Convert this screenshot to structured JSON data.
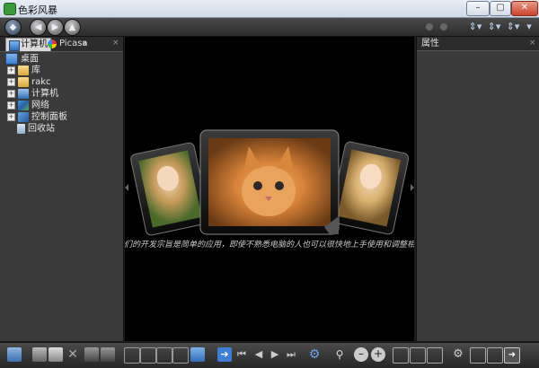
{
  "window": {
    "title": "色彩风暴",
    "controls": {
      "minimize": "–",
      "restore": "▢",
      "close": "✕"
    }
  },
  "left_panel": {
    "tabs": [
      {
        "label": "计算机",
        "icon": "computer-icon"
      },
      {
        "label": "Picasa",
        "icon": "picasa-icon"
      }
    ],
    "overflow_label": "»",
    "close_label": "×",
    "tree": [
      {
        "label": "桌面",
        "icon": "desktop-icon",
        "expandable": false
      },
      {
        "label": "库",
        "icon": "library-folder-icon",
        "expandable": true
      },
      {
        "label": "rakc",
        "icon": "user-folder-icon",
        "expandable": true
      },
      {
        "label": "计算机",
        "icon": "computer-icon",
        "expandable": true
      },
      {
        "label": "网络",
        "icon": "network-icon",
        "expandable": true
      },
      {
        "label": "控制面板",
        "icon": "control-panel-icon",
        "expandable": true
      },
      {
        "label": "回收站",
        "icon": "recycle-bin-icon",
        "expandable": false
      }
    ]
  },
  "right_panel": {
    "title": "属性",
    "close_label": "×"
  },
  "viewer": {
    "caption": "我们的开发宗旨是简单的应用，即使不熟悉电脑的人也可以很快地上手使用和调整相片"
  },
  "colors": {
    "panel_bg": "#3a3a3a",
    "viewer_bg": "#000000",
    "toolbar_bg": "#333333",
    "accent_blue": "#3d7fd6"
  }
}
